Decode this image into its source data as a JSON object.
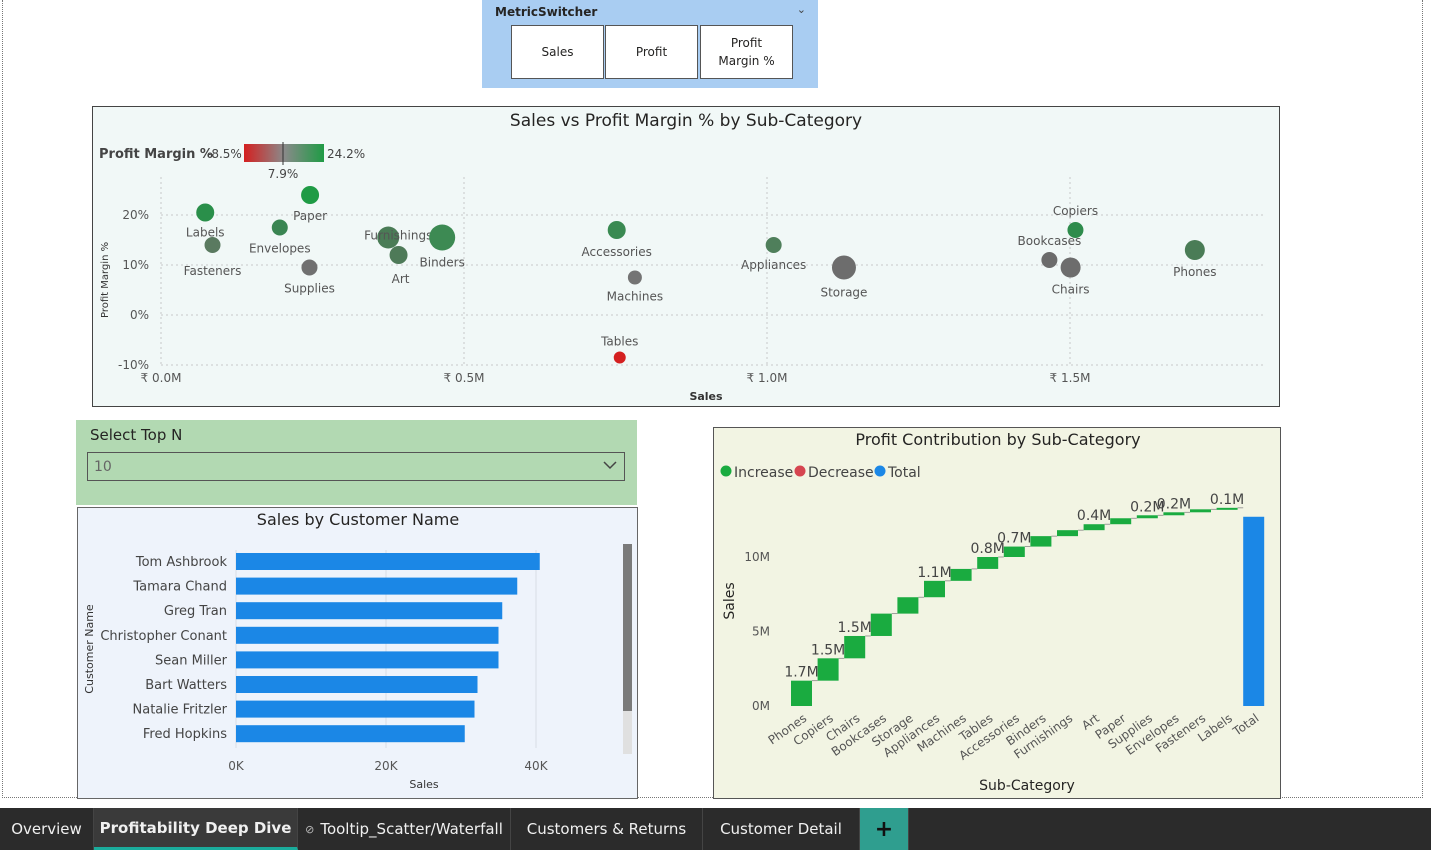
{
  "metric_switcher": {
    "title": "MetricSwitcher",
    "buttons": [
      {
        "label": "Sales"
      },
      {
        "label": "Profit"
      },
      {
        "label": "Profit\nMargin %"
      }
    ]
  },
  "scatter": {
    "title": "Sales vs Profit Margin % by Sub-Category",
    "legend_label": "Profit Margin %",
    "legend_min": "-8.5%",
    "legend_max": "24.2%",
    "legend_mid": "7.9%",
    "xlabel": "Sales",
    "ylabel": "Profit Margin %",
    "x_ticks": [
      "₹ 0.0M",
      "₹ 0.5M",
      "₹ 1.0M",
      "₹ 1.5M"
    ],
    "y_ticks": [
      "20%",
      "10%",
      "0%",
      "-10%"
    ]
  },
  "topn": {
    "label": "Select Top N",
    "value": "10"
  },
  "bar": {
    "title": "Sales by Customer Name",
    "xlabel": "Sales",
    "ylabel": "Customer Name",
    "x_ticks": [
      "0K",
      "20K",
      "40K"
    ]
  },
  "waterfall": {
    "title": "Profit Contribution by Sub-Category",
    "legend": [
      {
        "label": "Increase",
        "color": "#1aab40"
      },
      {
        "label": "Decrease",
        "color": "#d64550"
      },
      {
        "label": "Total",
        "color": "#1b87e6"
      }
    ],
    "xlabel": "Sub-Category",
    "ylabel": "Sales",
    "y_ticks": [
      "10M",
      "5M",
      "0M"
    ]
  },
  "tabs": [
    {
      "label": "Overview",
      "active": false
    },
    {
      "label": "Profitability Deep Dive",
      "active": true
    },
    {
      "label": "Tooltip_Scatter/Waterfall",
      "active": false,
      "hidden": true
    },
    {
      "label": "Customers & Returns",
      "active": false
    },
    {
      "label": "Customer Detail",
      "active": false
    },
    {
      "label": "+",
      "active": false
    }
  ],
  "chart_data": [
    {
      "type": "scatter",
      "title": "Sales vs Profit Margin % by Sub-Category",
      "xlabel": "Sales",
      "ylabel": "Profit Margin %",
      "xlim": [
        0,
        1900000
      ],
      "ylim": [
        -10,
        25
      ],
      "points": [
        {
          "name": "Labels",
          "x": 73000,
          "y": 20.5,
          "size": 8,
          "color": "#2a8f4a"
        },
        {
          "name": "Fasteners",
          "x": 85000,
          "y": 14,
          "size": 7,
          "color": "#5a7a60"
        },
        {
          "name": "Envelopes",
          "x": 196000,
          "y": 17.5,
          "size": 7,
          "color": "#3a8552"
        },
        {
          "name": "Paper",
          "x": 246000,
          "y": 24,
          "size": 8,
          "color": "#1f9b45"
        },
        {
          "name": "Supplies",
          "x": 245000,
          "y": 9.5,
          "size": 7,
          "color": "#707070"
        },
        {
          "name": "Furnishings",
          "x": 375000,
          "y": 15.5,
          "size": 10,
          "color": "#4a7c56"
        },
        {
          "name": "Art",
          "x": 392000,
          "y": 12,
          "size": 8,
          "color": "#4e7a58"
        },
        {
          "name": "Binders",
          "x": 464000,
          "y": 15.5,
          "size": 12,
          "color": "#3d8a53"
        },
        {
          "name": "Accessories",
          "x": 752000,
          "y": 17,
          "size": 8,
          "color": "#3a8a52"
        },
        {
          "name": "Machines",
          "x": 782000,
          "y": 7.5,
          "size": 6,
          "color": "#747474"
        },
        {
          "name": "Tables",
          "x": 757000,
          "y": -8.5,
          "size": 5,
          "color": "#d42020"
        },
        {
          "name": "Appliances",
          "x": 1011000,
          "y": 14,
          "size": 7,
          "color": "#4f7f5b"
        },
        {
          "name": "Storage",
          "x": 1127000,
          "y": 9.5,
          "size": 11,
          "color": "#6d6d6d"
        },
        {
          "name": "Copiers",
          "x": 1509000,
          "y": 17,
          "size": 7,
          "color": "#2e8c4c"
        },
        {
          "name": "Bookcases",
          "x": 1466000,
          "y": 11,
          "size": 7,
          "color": "#6b6b6b"
        },
        {
          "name": "Chairs",
          "x": 1501000,
          "y": 9.5,
          "size": 9,
          "color": "#6d6d6d"
        },
        {
          "name": "Phones",
          "x": 1706000,
          "y": 13,
          "size": 9,
          "color": "#4a7c56"
        }
      ]
    },
    {
      "type": "bar",
      "title": "Sales by Customer Name",
      "xlabel": "Sales",
      "ylabel": "Customer Name",
      "xlim": [
        0,
        45000
      ],
      "categories": [
        "Tom Ashbrook",
        "Tamara Chand",
        "Greg Tran",
        "Christopher Conant",
        "Sean Miller",
        "Bart Watters",
        "Natalie Fritzler",
        "Fred Hopkins"
      ],
      "values": [
        40500,
        37500,
        35500,
        35000,
        35000,
        32200,
        31800,
        30500
      ],
      "color": "#1b87e6"
    },
    {
      "type": "bar",
      "title": "Profit Contribution by Sub-Category",
      "xlabel": "Sub-Category",
      "ylabel": "Sales",
      "ylim": [
        0,
        12500000
      ],
      "categories": [
        "Phones",
        "Copiers",
        "Chairs",
        "Bookcases",
        "Storage",
        "Appliances",
        "Machines",
        "Tables",
        "Accessories",
        "Binders",
        "Furnishings",
        "Art",
        "Paper",
        "Supplies",
        "Envelopes",
        "Fasteners",
        "Labels",
        "Total"
      ],
      "values": [
        1.7,
        1.5,
        1.5,
        1.5,
        1.1,
        1.1,
        0.8,
        0.8,
        0.7,
        0.7,
        0.4,
        0.4,
        0.4,
        0.2,
        0.2,
        0.2,
        0.1,
        12.7
      ],
      "unit": "M",
      "data_labels": [
        "1.7M",
        "1.5M",
        "1.5M",
        "1.1M",
        "0.8M",
        "0.7M",
        "0.4M",
        "0.2M",
        "0.2M",
        "0.1M"
      ],
      "series_types": "waterfall"
    }
  ]
}
